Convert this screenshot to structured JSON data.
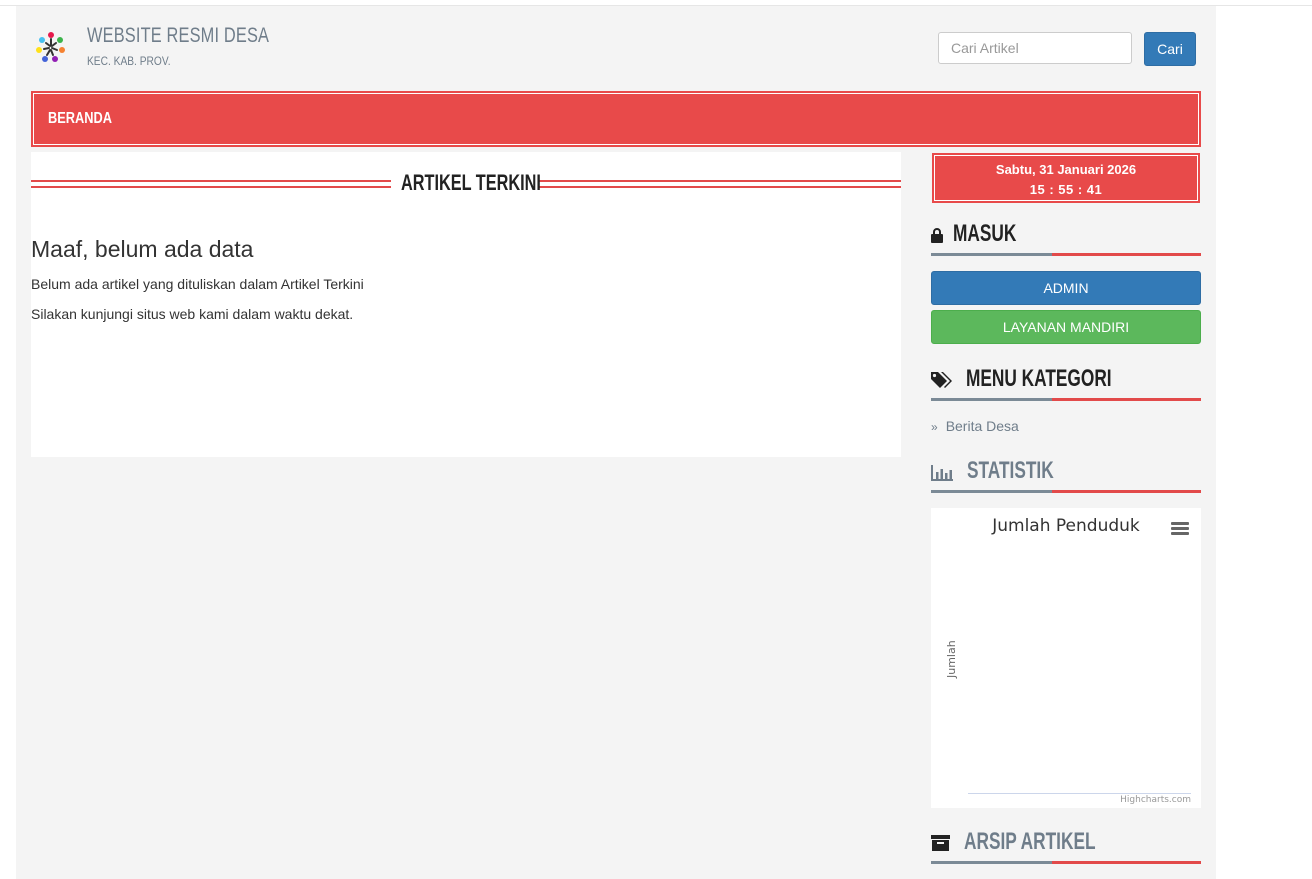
{
  "header": {
    "site_title": "WEBSITE RESMI DESA",
    "site_subtitle": "KEC. KAB. PROV.",
    "search_placeholder": "Cari Artikel",
    "search_button": "Cari"
  },
  "nav": {
    "items": [
      {
        "label": "BERANDA"
      }
    ]
  },
  "main": {
    "section_title": "ARTIKEL TERKINI",
    "empty_heading": "Maaf, belum ada data",
    "empty_line1": "Belum ada artikel yang dituliskan dalam Artikel Terkini",
    "empty_line2": "Silakan kunjungi situs web kami dalam waktu dekat."
  },
  "sidebar": {
    "clock": {
      "date": "Sabtu, 31 Januari 2026",
      "time": "15 : 55 : 41"
    },
    "login": {
      "title": "MASUK",
      "icon": "lock-icon",
      "admin_button": "ADMIN",
      "layanan_button": "LAYANAN MANDIRI"
    },
    "categories": {
      "title": "MENU KATEGORI",
      "icon": "tags-icon",
      "items": [
        {
          "label": "Berita Desa"
        }
      ]
    },
    "stats": {
      "title": "STATISTIK",
      "icon": "bar-chart-icon"
    },
    "archive": {
      "title": "ARSIP ARTIKEL",
      "icon": "archive-icon"
    }
  },
  "chart_data": {
    "type": "bar",
    "title": "Jumlah Penduduk",
    "ylabel": "Jumlah",
    "categories": [],
    "values": [],
    "credit": "Highcharts.com"
  },
  "colors": {
    "accent_red": "#e84a4a",
    "primary_blue": "#337ab7",
    "success_green": "#5cb85c",
    "muted_slate": "#6f7d8a"
  }
}
